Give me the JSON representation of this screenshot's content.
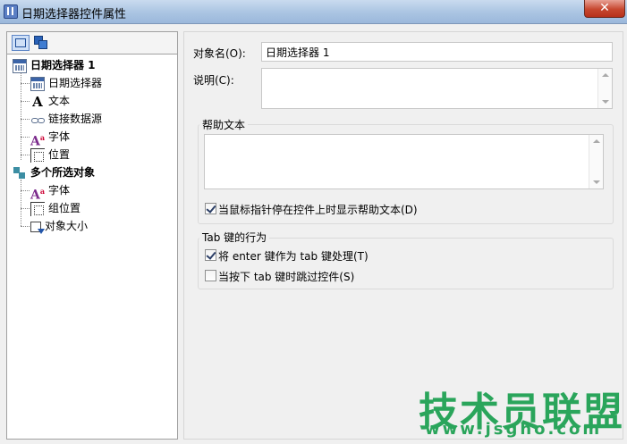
{
  "window": {
    "title": "日期选择器控件属性",
    "close_glyph": "✕"
  },
  "tree": {
    "items": [
      {
        "label": "日期选择器 1",
        "icon": "calendar-icon",
        "bold": true
      },
      {
        "label": "日期选择器",
        "icon": "calendar-icon"
      },
      {
        "label": "文本",
        "icon": "text-a-icon"
      },
      {
        "label": "链接数据源",
        "icon": "link-icon"
      },
      {
        "label": "字体",
        "icon": "font-icon"
      },
      {
        "label": "位置",
        "icon": "position-icon"
      },
      {
        "label": "多个所选对象",
        "icon": "multi-select-icon",
        "bold": true
      },
      {
        "label": "字体",
        "icon": "font-icon"
      },
      {
        "label": "组位置",
        "icon": "position-icon"
      },
      {
        "label": "对象大小",
        "icon": "size-icon"
      }
    ]
  },
  "form": {
    "object_name_label": "对象名(O):",
    "object_name_value": "日期选择器 1",
    "description_label": "说明(C):",
    "help_group_title": "帮助文本",
    "help_checkbox_label": "当鼠标指针停在控件上时显示帮助文本(D)",
    "help_checkbox_checked": true,
    "tab_group_title": "Tab 键的行为",
    "tab_enter_label": "将 enter 键作为 tab 键处理(T)",
    "tab_enter_checked": true,
    "tab_skip_label": "当按下 tab 键时跳过控件(S)",
    "tab_skip_checked": false
  },
  "watermark": {
    "line1": "技术员联盟",
    "line2": "www.jsgho.com"
  },
  "colors": {
    "watermark": "#2aa55b",
    "close_button": "#c7472f"
  }
}
